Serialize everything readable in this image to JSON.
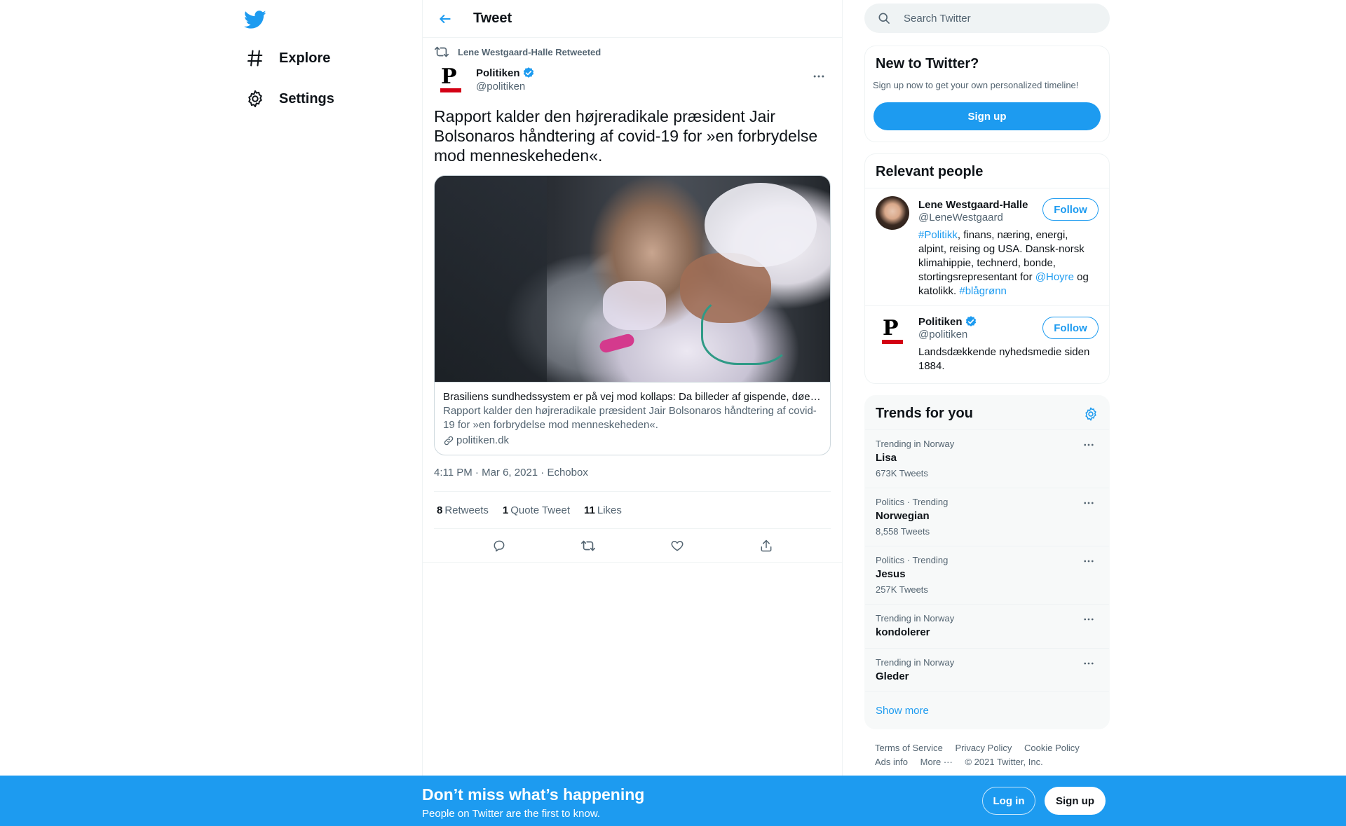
{
  "nav": {
    "explore_label": "Explore",
    "settings_label": "Settings"
  },
  "header": {
    "title": "Tweet"
  },
  "tweet": {
    "retweeted_by": "Lene Westgaard-Halle Retweeted",
    "author_name": "Politiken",
    "author_handle": "@politiken",
    "text": "Rapport kalder den højreradikale præsident Jair Bolsonaros håndtering af covid-19 for »en forbrydelse mod menneskeheden«.",
    "card": {
      "title": "Brasiliens sundhedssystem er på vej mod kollaps: Da billeder af gispende, døende patienter…",
      "description": "Rapport kalder den højreradikale præsident Jair Bolsonaros håndtering af covid-19 for »en forbrydelse mod menneskeheden«.",
      "domain": "politiken.dk"
    },
    "timestamp": "4:11 PM · Mar 6, 2021 · Echobox",
    "stats": {
      "retweets_count": "8",
      "retweets_label": "Retweets",
      "quotes_count": "1",
      "quotes_label": "Quote Tweet",
      "likes_count": "11",
      "likes_label": "Likes"
    }
  },
  "search": {
    "placeholder": "Search Twitter"
  },
  "new_to_twitter": {
    "title": "New to Twitter?",
    "subtitle": "Sign up now to get your own personalized timeline!",
    "signup_label": "Sign up"
  },
  "relevant_people": {
    "title": "Relevant people",
    "people": [
      {
        "name": "Lene Westgaard-Halle",
        "handle": "@LeneWestgaard",
        "follow_label": "Follow",
        "bio_parts": [
          "#Politikk",
          ", finans, næring, energi, alpint, reising og USA. Dansk-norsk klimahippie, technerd, bonde, stortingsrepresentant for ",
          "@Hoyre",
          " og katolikk. ",
          "#blågrønn"
        ]
      },
      {
        "name": "Politiken",
        "handle": "@politiken",
        "follow_label": "Follow",
        "bio": "Landsdækkende nyhedsmedie siden 1884."
      }
    ]
  },
  "trends": {
    "title": "Trends for you",
    "items": [
      {
        "meta": "Trending in Norway",
        "name": "Lisa",
        "count": "673K Tweets"
      },
      {
        "meta": "Politics · Trending",
        "name": "Norwegian",
        "count": "8,558 Tweets"
      },
      {
        "meta": "Politics · Trending",
        "name": "Jesus",
        "count": "257K Tweets"
      },
      {
        "meta": "Trending in Norway",
        "name": "kondolerer",
        "count": ""
      },
      {
        "meta": "Trending in Norway",
        "name": "Gleder",
        "count": ""
      }
    ],
    "show_more": "Show more"
  },
  "footer": {
    "links": [
      "Terms of Service",
      "Privacy Policy",
      "Cookie Policy",
      "Ads info",
      "More ···",
      "© 2021 Twitter, Inc."
    ]
  },
  "bottom_bar": {
    "title": "Don’t miss what’s happening",
    "subtitle": "People on Twitter are the first to know.",
    "login_label": "Log in",
    "signup_label": "Sign up"
  },
  "colors": {
    "accent": "#1d9bf0",
    "text_secondary": "#536471",
    "politiken_red": "#d30014"
  }
}
